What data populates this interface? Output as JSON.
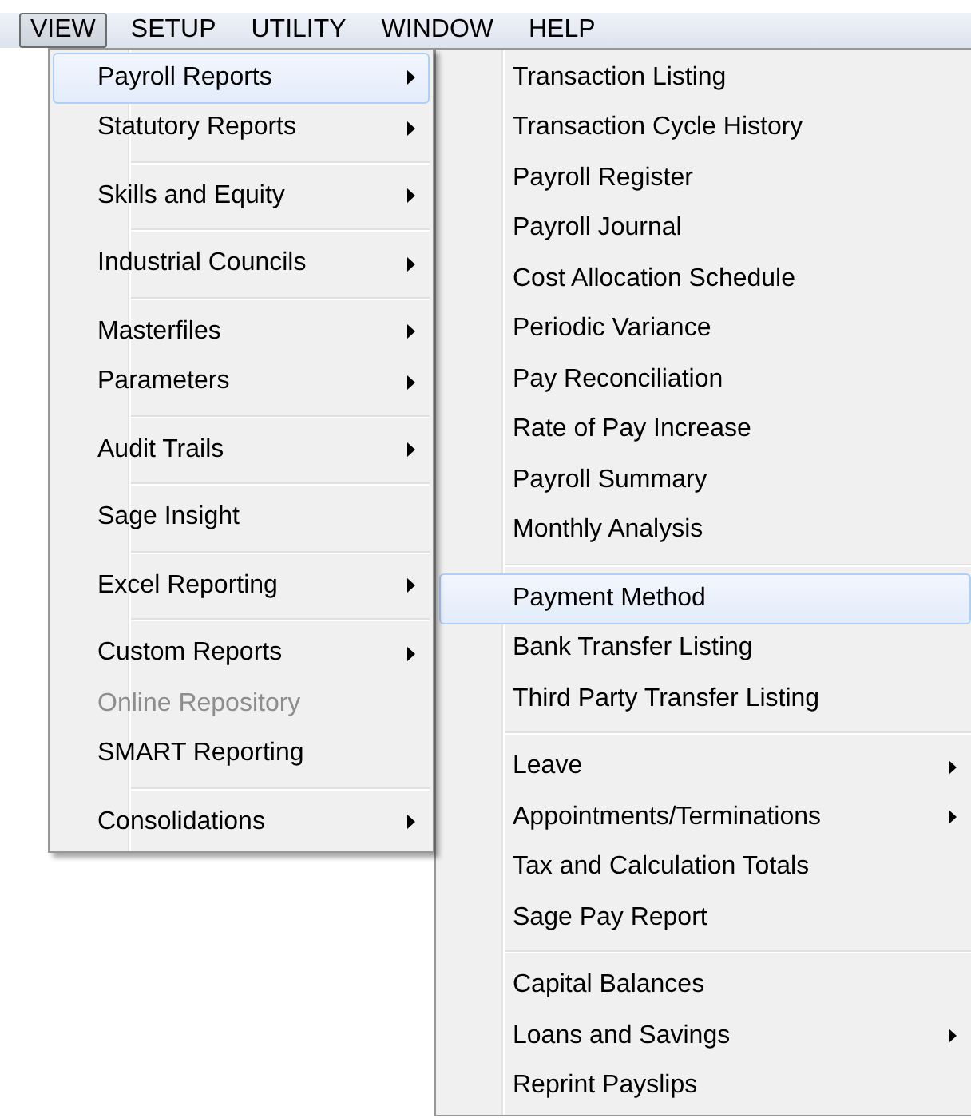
{
  "menu_bar": [
    {
      "label": "VIEW",
      "selected": true
    },
    {
      "label": "SETUP",
      "selected": false
    },
    {
      "label": "UTILITY",
      "selected": false
    },
    {
      "label": "WINDOW",
      "selected": false
    },
    {
      "label": "HELP",
      "selected": false
    }
  ],
  "view_menu": {
    "groups": [
      [
        {
          "label": "Payroll Reports",
          "submenu": true,
          "selected": true,
          "disabled": false
        },
        {
          "label": "Statutory Reports",
          "submenu": true,
          "selected": false,
          "disabled": false
        }
      ],
      [
        {
          "label": "Skills and Equity",
          "submenu": true,
          "selected": false,
          "disabled": false
        }
      ],
      [
        {
          "label": "Industrial Councils",
          "submenu": true,
          "selected": false,
          "disabled": false
        }
      ],
      [
        {
          "label": "Masterfiles",
          "submenu": true,
          "selected": false,
          "disabled": false
        },
        {
          "label": "Parameters",
          "submenu": true,
          "selected": false,
          "disabled": false
        }
      ],
      [
        {
          "label": "Audit Trails",
          "submenu": true,
          "selected": false,
          "disabled": false
        }
      ],
      [
        {
          "label": "Sage Insight",
          "submenu": false,
          "selected": false,
          "disabled": false
        }
      ],
      [
        {
          "label": "Excel Reporting",
          "submenu": true,
          "selected": false,
          "disabled": false
        }
      ],
      [
        {
          "label": "Custom Reports",
          "submenu": true,
          "selected": false,
          "disabled": false
        },
        {
          "label": "Online Repository",
          "submenu": false,
          "selected": false,
          "disabled": true
        },
        {
          "label": "SMART Reporting",
          "submenu": false,
          "selected": false,
          "disabled": false
        }
      ],
      [
        {
          "label": "Consolidations",
          "submenu": true,
          "selected": false,
          "disabled": false
        }
      ]
    ]
  },
  "payroll_reports_menu": {
    "groups": [
      [
        {
          "label": "Transaction Listing",
          "submenu": false,
          "selected": false,
          "disabled": false
        },
        {
          "label": "Transaction Cycle History",
          "submenu": false,
          "selected": false,
          "disabled": false
        },
        {
          "label": "Payroll Register",
          "submenu": false,
          "selected": false,
          "disabled": false
        },
        {
          "label": "Payroll Journal",
          "submenu": false,
          "selected": false,
          "disabled": false
        },
        {
          "label": "Cost Allocation Schedule",
          "submenu": false,
          "selected": false,
          "disabled": false
        },
        {
          "label": "Periodic Variance",
          "submenu": false,
          "selected": false,
          "disabled": false
        },
        {
          "label": "Pay Reconciliation",
          "submenu": false,
          "selected": false,
          "disabled": false
        },
        {
          "label": "Rate of Pay Increase",
          "submenu": false,
          "selected": false,
          "disabled": false
        },
        {
          "label": "Payroll Summary",
          "submenu": false,
          "selected": false,
          "disabled": false
        },
        {
          "label": "Monthly Analysis",
          "submenu": false,
          "selected": false,
          "disabled": false
        }
      ],
      [
        {
          "label": "Payment Method",
          "submenu": false,
          "selected": true,
          "disabled": false
        },
        {
          "label": "Bank Transfer Listing",
          "submenu": false,
          "selected": false,
          "disabled": false
        },
        {
          "label": "Third Party Transfer Listing",
          "submenu": false,
          "selected": false,
          "disabled": false
        }
      ],
      [
        {
          "label": "Leave",
          "submenu": true,
          "selected": false,
          "disabled": false
        },
        {
          "label": "Appointments/Terminations",
          "submenu": true,
          "selected": false,
          "disabled": false
        },
        {
          "label": "Tax and Calculation Totals",
          "submenu": false,
          "selected": false,
          "disabled": false
        },
        {
          "label": "Sage Pay Report",
          "submenu": false,
          "selected": false,
          "disabled": false
        }
      ],
      [
        {
          "label": "Capital Balances",
          "submenu": false,
          "selected": false,
          "disabled": false
        },
        {
          "label": "Loans and Savings",
          "submenu": true,
          "selected": false,
          "disabled": false
        },
        {
          "label": "Reprint Payslips",
          "submenu": false,
          "selected": false,
          "disabled": false
        }
      ]
    ]
  }
}
